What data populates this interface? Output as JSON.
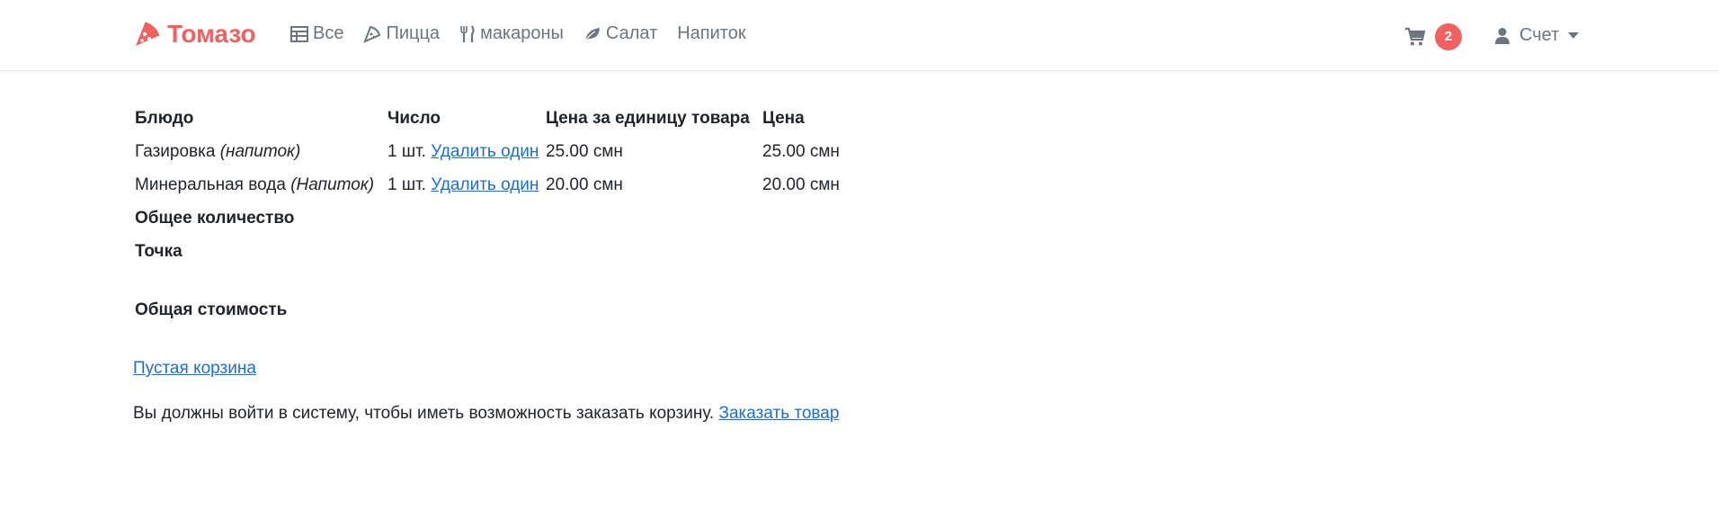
{
  "nav": {
    "brand": "Томазо",
    "links": [
      {
        "label": "Все",
        "icon": "table-icon"
      },
      {
        "label": "Пицца",
        "icon": "pizza-slice-icon"
      },
      {
        "label": "макароны",
        "icon": "utensils-icon"
      },
      {
        "label": "Салат",
        "icon": "leaf-icon"
      },
      {
        "label": "Напиток",
        "icon": ""
      }
    ],
    "cart_count": "2",
    "account_label": "Счет"
  },
  "colors": {
    "brand": "#f0625f",
    "link": "#1a6fd6",
    "muted": "#6c757d"
  },
  "table": {
    "headers": {
      "dish": "Блюдо",
      "quantity": "Число",
      "unit_price": "Цена за единицу товара",
      "price": "Цена"
    },
    "rows": [
      {
        "name": "Газировка",
        "category": "(напиток)",
        "quantity": "1 шт.",
        "remove_label": "Удалить один",
        "unit_price": "25.00 смн",
        "price": "25.00 смн"
      },
      {
        "name": "Минеральная вода",
        "category": "(Напиток)",
        "quantity": "1 шт.",
        "remove_label": "Удалить один",
        "unit_price": "20.00 смн",
        "price": "20.00 смн"
      }
    ],
    "total_quantity_label": "Общее количество",
    "point_label": "Точка"
  },
  "total_cost_label": "Общая стоимость",
  "empty_cart_label": "Пустая корзина",
  "login_note": "Вы должны войти в систему, чтобы иметь возможность заказать корзину.",
  "order_link": "Заказать товар"
}
